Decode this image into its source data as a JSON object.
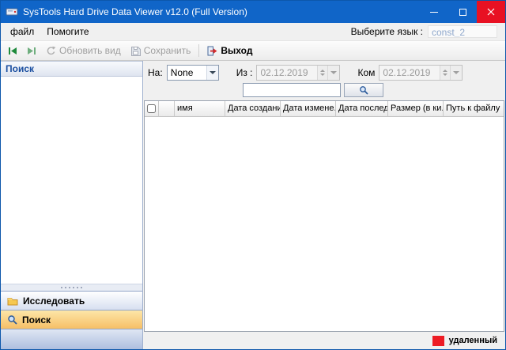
{
  "window": {
    "title": "SysTools Hard Drive Data Viewer v12.0 (Full Version)"
  },
  "menu": {
    "items": [
      {
        "label": "файл"
      },
      {
        "label": "Помогите"
      }
    ],
    "language_label": "Выберите язык :",
    "language_value": "const_2"
  },
  "toolbar": {
    "refresh_label": "Обновить вид",
    "save_label": "Сохранить",
    "exit_label": "Выход"
  },
  "sidebar": {
    "header": "Поиск",
    "buttons": [
      {
        "label": "Исследовать"
      },
      {
        "label": "Поиск"
      }
    ]
  },
  "search_panel": {
    "na_label": "На:",
    "na_value": "None",
    "from_label": "Из :",
    "from_value": "02.12.2019",
    "to_label": "Ком",
    "to_value": "02.12.2019"
  },
  "table": {
    "columns": [
      "имя",
      "Дата создания",
      "Дата измене...",
      "Дата послед...",
      "Размер (в ки...",
      "Путь к файлу"
    ]
  },
  "legend": {
    "deleted_label": "удаленный",
    "deleted_color": "#ed1c24"
  },
  "colors": {
    "titlebar": "#1065c8",
    "close_button": "#e81123",
    "selected_nav": "#f6bf66",
    "sidebar_header_text": "#1b4fa0"
  }
}
